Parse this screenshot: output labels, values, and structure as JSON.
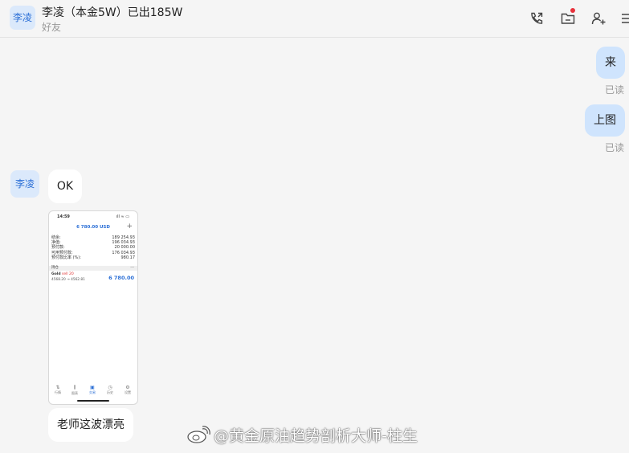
{
  "header": {
    "avatar_text": "李凌",
    "title": "李凌（本金5W）已出185W",
    "subtitle": "好友",
    "icons": [
      "phone-call-icon",
      "folder-icon",
      "add-user-icon",
      "menu-icon"
    ]
  },
  "messages": {
    "m1": {
      "text": "来",
      "status": "已读"
    },
    "m2": {
      "text": "上图",
      "status": "已读"
    },
    "m3": {
      "avatar_text": "李凌",
      "text": "OK"
    },
    "m5": {
      "text": "老师这波漂亮"
    }
  },
  "phone": {
    "time": "14:59",
    "signal": "ıll ≈ ▭",
    "balance_title": "6 780.00 USD",
    "rows": [
      {
        "label": "结余:",
        "value": "189 254.93"
      },
      {
        "label": "净值:",
        "value": "196 034.93"
      },
      {
        "label": "预付款:",
        "value": "20 000.00"
      },
      {
        "label": "可用预付款:",
        "value": "176 034.93"
      },
      {
        "label": "预付款比率 (%):",
        "value": "980.17"
      }
    ],
    "positions_label": "持仓",
    "gold_symbol": "Gold",
    "gold_side": "sell 20",
    "gold_prices": "4568.20 → 4562.81",
    "gold_profit": "6 780.00",
    "tabs": [
      "行情",
      "图表",
      "交易",
      "历史",
      "设置"
    ]
  },
  "watermark": "@黄金原油趋势剖析大师-柱生"
}
